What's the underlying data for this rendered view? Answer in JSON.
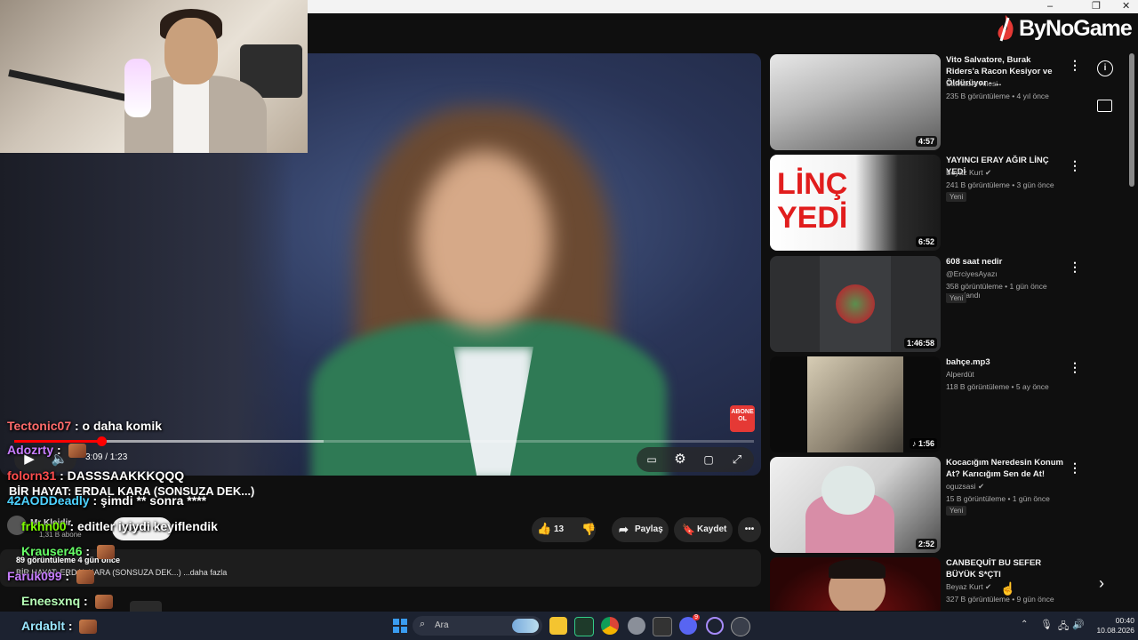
{
  "window": {
    "minimize": "–",
    "restore": "❐",
    "close": "✕"
  },
  "brand": {
    "logo_text": "ByNoGame"
  },
  "player": {
    "time": "3:09 / 1:23",
    "abone_badge": "ABONE OL",
    "progress_fraction": 0.118,
    "buffer_fraction": 0.418
  },
  "video_info": {
    "title": "BİR HAYAT: ERDAL KARA (SONSUZA DEK...)",
    "channel": "Mr Kleidir",
    "subscribers": "1,31 B abone",
    "subscribe_button": "Abone ol",
    "views_time": "89 görüntüleme  4 gün önce",
    "description": "BİR HAYAT: ERDAL KARA (SONSUZA DEK...) ...daha fazla",
    "likes": "13",
    "share_label": "Paylaş",
    "save_label": "Kaydet"
  },
  "chat": [
    {
      "user": "Tectonic07",
      "text": ": o daha komik",
      "color": "#ff6b6b"
    },
    {
      "user": "Adozrty",
      "text": ":",
      "color": "#c77dff"
    },
    {
      "user": "folorn31",
      "text": ": DASSSAAKKKQQQ",
      "color": "#ff4d4d"
    },
    {
      "user": "42AODDeadly",
      "text": ": şimdi ** sonra ****",
      "color": "#4dd2ff"
    },
    {
      "user": "frkhn00",
      "text": ": editler iyiydi keyiflendik",
      "color": "#7CFC00"
    },
    {
      "user": "Krauser46",
      "text": ":",
      "color": "#66ff66"
    },
    {
      "user": "Faruk099",
      "text": ":",
      "color": "#c77dff"
    },
    {
      "user": "Eneesxnq",
      "text": ":",
      "color": "#b6ffb6"
    },
    {
      "user": "Ardablt",
      "text": ":",
      "color": "#9be7ff"
    }
  ],
  "recommendations": [
    {
      "title": "Vito Salvatore, Burak Riders'a Racon Kesiyor ve Öldürüyor - ...",
      "channel": "Salvatore Ailesi",
      "meta": "235 B görüntüleme • 4 yıl önce",
      "badge": "",
      "duration": "4:57",
      "verified": false
    },
    {
      "title": "YAYINCI ERAY AĞIR LİNÇ YEDİ",
      "channel": "Beyaz Kurt",
      "meta": "241 B görüntüleme • 3 gün önce",
      "badge": "Yeni",
      "duration": "6:52",
      "verified": true,
      "thumb_text_1": "LİNÇ",
      "thumb_text_2": "YEDİ"
    },
    {
      "title": "608 saat nedir",
      "channel": "@ErciyesAyazı",
      "meta": "358 görüntüleme • 1 gün önce yayınlandı",
      "badge": "Yeni",
      "duration": "1:46:58",
      "verified": false
    },
    {
      "title": "bahçe.mp3",
      "channel": "Alperdüt",
      "meta": "118 B görüntüleme • 5 ay önce",
      "badge": "",
      "duration": "♪ 1:56",
      "verified": false
    },
    {
      "title": "Kocacığım Neredesin Konum At? Karıcığım Sen de At!",
      "channel": "oguzsasi",
      "meta": "15 B görüntüleme • 1 gün önce",
      "badge": "Yeni",
      "duration": "2:52",
      "verified": true
    },
    {
      "title": "CANBEQUİT BU SEFER BÜYÜK S*ÇTI",
      "channel": "Beyaz Kurt",
      "meta": "327 B görüntüleme • 9 gün önce",
      "badge": "",
      "duration": "",
      "verified": true
    }
  ],
  "taskbar": {
    "search_placeholder": "Ara",
    "time": "00:40",
    "date": "10.08.2026",
    "discord_badge": "9"
  }
}
